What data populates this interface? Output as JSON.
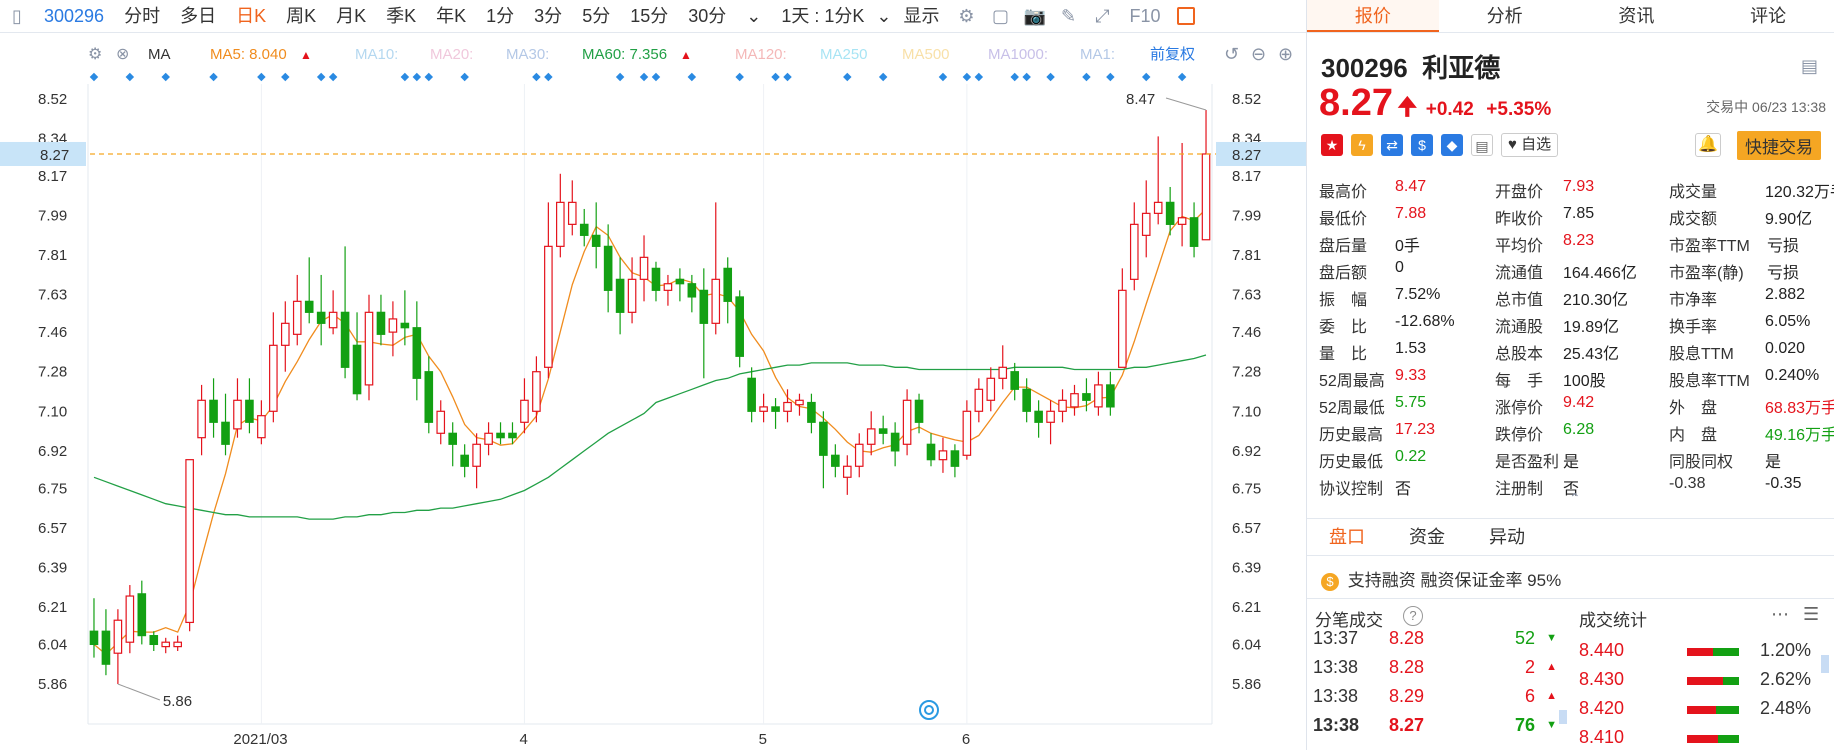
{
  "toolbar": {
    "code": "300296",
    "items": [
      "分时",
      "多日",
      "日K",
      "周K",
      "月K",
      "季K",
      "年K",
      "1分",
      "3分",
      "5分",
      "15分",
      "30分"
    ],
    "active_index": 2,
    "interval": "1天 : 1分K",
    "display": "显示",
    "f10": "F10"
  },
  "ma_legend": {
    "ma_label": "MA",
    "ma5": "MA5: 8.040",
    "ma10": "MA10:",
    "ma20": "MA20:",
    "ma30": "MA30:",
    "ma60": "MA60: 7.356",
    "ma120": "MA120:",
    "ma250": "MA250",
    "ma500": "MA500",
    "ma1000": "MA1000:",
    "ma1": "MA1:",
    "adjust": "前复权"
  },
  "chart_data": {
    "type": "candlestick",
    "y_ticks": [
      "8.52",
      "8.34",
      "8.17",
      "7.99",
      "7.81",
      "7.63",
      "7.46",
      "7.28",
      "7.10",
      "6.92",
      "6.75",
      "6.57",
      "6.39",
      "6.21",
      "6.04",
      "5.86"
    ],
    "ylim": [
      5.86,
      8.52
    ],
    "x_ticks": [
      {
        "label": "2021/03",
        "i": 10
      },
      {
        "label": "4",
        "i": 25
      },
      {
        "label": "5",
        "i": 39
      },
      {
        "label": "6",
        "i": 51
      }
    ],
    "current_price_label": "8.27",
    "current_price": 8.27,
    "max_label": "8.47",
    "min_label": "5.86",
    "candles": [
      {
        "o": 6.1,
        "c": 6.04,
        "h": 6.25,
        "l": 5.98
      },
      {
        "o": 6.1,
        "c": 5.95,
        "h": 6.2,
        "l": 5.9
      },
      {
        "o": 6.0,
        "c": 6.15,
        "h": 6.2,
        "l": 5.86
      },
      {
        "o": 6.05,
        "c": 6.26,
        "h": 6.31,
        "l": 6.0
      },
      {
        "o": 6.27,
        "c": 6.08,
        "h": 6.33,
        "l": 6.04
      },
      {
        "o": 6.08,
        "c": 6.04,
        "h": 6.1,
        "l": 6.01
      },
      {
        "o": 6.03,
        "c": 6.05,
        "h": 6.07,
        "l": 6.0
      },
      {
        "o": 6.03,
        "c": 6.05,
        "h": 6.08,
        "l": 6.01
      },
      {
        "o": 6.14,
        "c": 6.88,
        "h": 6.88,
        "l": 6.1
      },
      {
        "o": 6.98,
        "c": 7.15,
        "h": 7.22,
        "l": 6.9
      },
      {
        "o": 7.15,
        "c": 7.05,
        "h": 7.25,
        "l": 6.98
      },
      {
        "o": 7.05,
        "c": 6.95,
        "h": 7.18,
        "l": 6.9
      },
      {
        "o": 7.02,
        "c": 7.15,
        "h": 7.25,
        "l": 6.98
      },
      {
        "o": 7.15,
        "c": 7.05,
        "h": 7.25,
        "l": 7.0
      },
      {
        "o": 6.98,
        "c": 7.08,
        "h": 7.15,
        "l": 6.95
      },
      {
        "o": 7.1,
        "c": 7.4,
        "h": 7.55,
        "l": 7.05
      },
      {
        "o": 7.4,
        "c": 7.5,
        "h": 7.6,
        "l": 7.28
      },
      {
        "o": 7.45,
        "c": 7.6,
        "h": 7.72,
        "l": 7.4
      },
      {
        "o": 7.6,
        "c": 7.55,
        "h": 7.8,
        "l": 7.5
      },
      {
        "o": 7.55,
        "c": 7.5,
        "h": 7.72,
        "l": 7.4
      },
      {
        "o": 7.48,
        "c": 7.55,
        "h": 7.65,
        "l": 7.45
      },
      {
        "o": 7.55,
        "c": 7.3,
        "h": 7.85,
        "l": 7.25
      },
      {
        "o": 7.4,
        "c": 7.18,
        "h": 7.55,
        "l": 7.15
      },
      {
        "o": 7.22,
        "c": 7.55,
        "h": 7.63,
        "l": 7.15
      },
      {
        "o": 7.55,
        "c": 7.45,
        "h": 7.63,
        "l": 7.4
      },
      {
        "o": 7.46,
        "c": 7.52,
        "h": 7.6,
        "l": 7.35
      },
      {
        "o": 7.5,
        "c": 7.48,
        "h": 7.65,
        "l": 7.4
      },
      {
        "o": 7.48,
        "c": 7.25,
        "h": 7.6,
        "l": 7.15
      },
      {
        "o": 7.28,
        "c": 7.05,
        "h": 7.35,
        "l": 7.0
      },
      {
        "o": 7.0,
        "c": 7.1,
        "h": 7.15,
        "l": 6.95
      },
      {
        "o": 7.0,
        "c": 6.95,
        "h": 7.05,
        "l": 6.85
      },
      {
        "o": 6.9,
        "c": 6.85,
        "h": 6.95,
        "l": 6.8
      },
      {
        "o": 6.85,
        "c": 6.95,
        "h": 7.0,
        "l": 6.75
      },
      {
        "o": 6.95,
        "c": 7.0,
        "h": 7.05,
        "l": 6.9
      },
      {
        "o": 7.0,
        "c": 6.98,
        "h": 7.05,
        "l": 6.95
      },
      {
        "o": 7.0,
        "c": 6.98,
        "h": 7.05,
        "l": 6.95
      },
      {
        "o": 7.05,
        "c": 7.15,
        "h": 7.25,
        "l": 7.0
      },
      {
        "o": 7.1,
        "c": 7.28,
        "h": 7.35,
        "l": 7.05
      },
      {
        "o": 7.3,
        "c": 7.85,
        "h": 8.05,
        "l": 7.25
      },
      {
        "o": 7.85,
        "c": 8.05,
        "h": 8.18,
        "l": 7.8
      },
      {
        "o": 7.95,
        "c": 8.05,
        "h": 8.15,
        "l": 7.9
      },
      {
        "o": 7.95,
        "c": 7.9,
        "h": 8.02,
        "l": 7.85
      },
      {
        "o": 7.9,
        "c": 7.85,
        "h": 8.05,
        "l": 7.75
      },
      {
        "o": 7.85,
        "c": 7.65,
        "h": 7.95,
        "l": 7.55
      },
      {
        "o": 7.7,
        "c": 7.55,
        "h": 7.8,
        "l": 7.45
      },
      {
        "o": 7.55,
        "c": 7.7,
        "h": 7.8,
        "l": 7.5
      },
      {
        "o": 7.7,
        "c": 7.8,
        "h": 7.9,
        "l": 7.6
      },
      {
        "o": 7.75,
        "c": 7.65,
        "h": 7.78,
        "l": 7.6
      },
      {
        "o": 7.65,
        "c": 7.68,
        "h": 7.72,
        "l": 7.58
      },
      {
        "o": 7.7,
        "c": 7.68,
        "h": 7.75,
        "l": 7.6
      },
      {
        "o": 7.68,
        "c": 7.62,
        "h": 7.72,
        "l": 7.55
      },
      {
        "o": 7.65,
        "c": 7.5,
        "h": 7.75,
        "l": 7.25
      },
      {
        "o": 7.5,
        "c": 7.7,
        "h": 8.05,
        "l": 7.45
      },
      {
        "o": 7.75,
        "c": 7.6,
        "h": 7.8,
        "l": 7.5
      },
      {
        "o": 7.62,
        "c": 7.35,
        "h": 7.65,
        "l": 7.3
      },
      {
        "o": 7.25,
        "c": 7.1,
        "h": 7.3,
        "l": 7.05
      },
      {
        "o": 7.1,
        "c": 7.12,
        "h": 7.18,
        "l": 7.05
      },
      {
        "o": 7.12,
        "c": 7.1,
        "h": 7.16,
        "l": 7.02
      },
      {
        "o": 7.1,
        "c": 7.14,
        "h": 7.2,
        "l": 7.05
      },
      {
        "o": 7.13,
        "c": 7.15,
        "h": 7.18,
        "l": 7.08
      },
      {
        "o": 7.14,
        "c": 7.05,
        "h": 7.18,
        "l": 7.0
      },
      {
        "o": 7.05,
        "c": 6.9,
        "h": 7.1,
        "l": 6.75
      },
      {
        "o": 6.9,
        "c": 6.85,
        "h": 6.95,
        "l": 6.8
      },
      {
        "o": 6.8,
        "c": 6.85,
        "h": 6.9,
        "l": 6.72
      },
      {
        "o": 6.85,
        "c": 6.95,
        "h": 7.0,
        "l": 6.8
      },
      {
        "o": 6.95,
        "c": 7.02,
        "h": 7.1,
        "l": 6.9
      },
      {
        "o": 7.02,
        "c": 7.0,
        "h": 7.08,
        "l": 6.95
      },
      {
        "o": 7.0,
        "c": 6.92,
        "h": 7.05,
        "l": 6.85
      },
      {
        "o": 6.95,
        "c": 7.15,
        "h": 7.2,
        "l": 6.9
      },
      {
        "o": 7.15,
        "c": 7.05,
        "h": 7.18,
        "l": 7.0
      },
      {
        "o": 6.95,
        "c": 6.88,
        "h": 7.0,
        "l": 6.85
      },
      {
        "o": 6.88,
        "c": 6.92,
        "h": 6.98,
        "l": 6.82
      },
      {
        "o": 6.92,
        "c": 6.85,
        "h": 6.95,
        "l": 6.8
      },
      {
        "o": 6.9,
        "c": 7.1,
        "h": 7.15,
        "l": 6.88
      },
      {
        "o": 7.1,
        "c": 7.2,
        "h": 7.25,
        "l": 7.05
      },
      {
        "o": 7.15,
        "c": 7.25,
        "h": 7.3,
        "l": 7.1
      },
      {
        "o": 7.25,
        "c": 7.3,
        "h": 7.4,
        "l": 7.2
      },
      {
        "o": 7.28,
        "c": 7.2,
        "h": 7.32,
        "l": 7.15
      },
      {
        "o": 7.2,
        "c": 7.1,
        "h": 7.25,
        "l": 7.05
      },
      {
        "o": 7.1,
        "c": 7.05,
        "h": 7.15,
        "l": 6.98
      },
      {
        "o": 7.05,
        "c": 7.1,
        "h": 7.15,
        "l": 6.95
      },
      {
        "o": 7.1,
        "c": 7.15,
        "h": 7.2,
        "l": 7.05
      },
      {
        "o": 7.12,
        "c": 7.18,
        "h": 7.22,
        "l": 7.08
      },
      {
        "o": 7.18,
        "c": 7.15,
        "h": 7.25,
        "l": 7.1
      },
      {
        "o": 7.12,
        "c": 7.22,
        "h": 7.28,
        "l": 7.08
      },
      {
        "o": 7.22,
        "c": 7.12,
        "h": 7.28,
        "l": 7.08
      },
      {
        "o": 7.3,
        "c": 7.65,
        "h": 7.75,
        "l": 7.45
      },
      {
        "o": 7.7,
        "c": 7.95,
        "h": 8.05,
        "l": 7.65
      },
      {
        "o": 7.9,
        "c": 8.0,
        "h": 8.15,
        "l": 7.8
      },
      {
        "o": 8.0,
        "c": 8.05,
        "h": 8.35,
        "l": 7.95
      },
      {
        "o": 8.05,
        "c": 7.95,
        "h": 8.12,
        "l": 7.9
      },
      {
        "o": 7.95,
        "c": 7.98,
        "h": 8.32,
        "l": 7.85
      },
      {
        "o": 7.98,
        "c": 7.85,
        "h": 8.05,
        "l": 7.8
      },
      {
        "o": 7.88,
        "c": 8.27,
        "h": 8.47,
        "l": 7.88
      }
    ]
  },
  "panel": {
    "tabs": [
      "报价",
      "分析",
      "资讯",
      "评论"
    ],
    "code": "300296",
    "name": "利亚德",
    "price": "8.27",
    "change": "+0.42",
    "change_pct": "+5.35%",
    "status": "交易中 06/23 13:38",
    "watch": "自选",
    "quick_trade": "快捷交易",
    "quotes_col1": [
      {
        "label": "最高价",
        "value": "8.47",
        "color": "red"
      },
      {
        "label": "最低价",
        "value": "7.88",
        "color": "red"
      },
      {
        "label": "盘后量",
        "value": "0手",
        "color": "black"
      },
      {
        "label": "盘后额",
        "value": "0",
        "color": "black"
      },
      {
        "label": "振　幅",
        "value": "7.52%",
        "color": "black"
      },
      {
        "label": "委　比",
        "value": "-12.68%",
        "color": "black"
      },
      {
        "label": "量　比",
        "value": "1.53",
        "color": "black"
      },
      {
        "label": "52周最高",
        "value": "9.33",
        "color": "red"
      },
      {
        "label": "52周最低",
        "value": "5.75",
        "color": "green"
      },
      {
        "label": "历史最高",
        "value": "17.23",
        "color": "red"
      },
      {
        "label": "历史最低",
        "value": "0.22",
        "color": "green"
      },
      {
        "label": "协议控制",
        "value": "否",
        "color": "black"
      }
    ],
    "quotes_col2": [
      {
        "label": "开盘价",
        "value": "7.93",
        "color": "red"
      },
      {
        "label": "昨收价",
        "value": "7.85",
        "color": "black"
      },
      {
        "label": "平均价",
        "value": "8.23",
        "color": "red"
      },
      {
        "label": "流通值",
        "value": "164.466亿",
        "color": "black"
      },
      {
        "label": "总市值",
        "value": "210.30亿",
        "color": "black"
      },
      {
        "label": "流通股",
        "value": "19.89亿",
        "color": "black"
      },
      {
        "label": "总股本",
        "value": "25.43亿",
        "color": "black"
      },
      {
        "label": "每　手",
        "value": "100股",
        "color": "black"
      },
      {
        "label": "涨停价",
        "value": "9.42",
        "color": "red"
      },
      {
        "label": "跌停价",
        "value": "6.28",
        "color": "green"
      },
      {
        "label": "是否盈利",
        "value": "是",
        "color": "black"
      },
      {
        "label": "注册制",
        "value": "否",
        "color": "black"
      }
    ],
    "quotes_col3": [
      {
        "label": "成交量",
        "value": "120.32万手",
        "color": "black"
      },
      {
        "label": "成交额",
        "value": "9.90亿",
        "color": "black"
      },
      {
        "label": "市盈率TTM",
        "value": "亏损",
        "color": "black"
      },
      {
        "label": "市盈率(静)",
        "value": "亏损",
        "color": "black"
      },
      {
        "label": "市净率",
        "value": "2.882",
        "color": "black"
      },
      {
        "label": "换手率",
        "value": "6.05%",
        "color": "black"
      },
      {
        "label": "股息TTM",
        "value": "0.020",
        "color": "black"
      },
      {
        "label": "股息率TTM",
        "value": "0.240%",
        "color": "black"
      },
      {
        "label": "外　盘",
        "value": "68.83万手",
        "color": "red"
      },
      {
        "label": "内　盘",
        "value": "49.16万手",
        "color": "green"
      },
      {
        "label": "同股同权",
        "value": "是",
        "color": "black"
      },
      {
        "label": "-0.38",
        "value": "-0.35",
        "color": "black"
      }
    ],
    "subtabs": [
      "盘口",
      "资金",
      "异动"
    ],
    "margin_info": "支持融资 融资保证金率 95%",
    "ticks_title": "分笔成交",
    "stats_title": "成交统计",
    "ticks": [
      {
        "time": "13:37",
        "price": "8.28",
        "vol": "52",
        "dir": "down"
      },
      {
        "time": "13:38",
        "price": "8.28",
        "vol": "2",
        "dir": "up"
      },
      {
        "time": "13:38",
        "price": "8.29",
        "vol": "6",
        "dir": "up"
      },
      {
        "time": "13:38",
        "price": "8.27",
        "vol": "76",
        "dir": "down"
      }
    ],
    "stats": [
      {
        "price": "8.440",
        "pct": "1.20%",
        "red": 0.5,
        "green": 0.5
      },
      {
        "price": "8.430",
        "pct": "2.62%",
        "red": 0.7,
        "green": 0.3
      },
      {
        "price": "8.420",
        "pct": "2.48%",
        "red": 0.55,
        "green": 0.45
      },
      {
        "price": "8.410",
        "pct": "",
        "red": 0.6,
        "green": 0.4
      }
    ]
  }
}
